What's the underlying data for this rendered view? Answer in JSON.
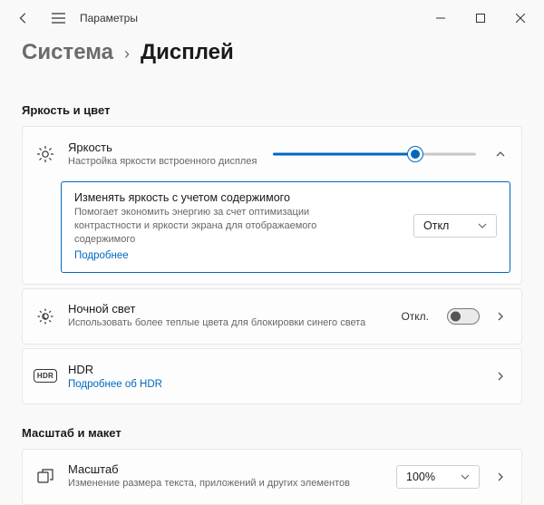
{
  "window": {
    "title": "Параметры"
  },
  "breadcrumb": {
    "parent": "Система",
    "separator": "›",
    "current": "Дисплей"
  },
  "sections": {
    "brightness_color": "Яркость и цвет",
    "scale_layout": "Масштаб и макет"
  },
  "brightness": {
    "title": "Яркость",
    "subtitle": "Настройка яркости встроенного дисплея",
    "value_percent": 70
  },
  "content_adaptive": {
    "title": "Изменять яркость с учетом содержимого",
    "description": "Помогает экономить энергию за счет оптимизации контрастности и яркости экрана для отображаемого содержимого",
    "more": "Подробнее",
    "dropdown_value": "Откл"
  },
  "night_light": {
    "title": "Ночной свет",
    "subtitle": "Использовать более теплые цвета для блокировки синего света",
    "state_label": "Откл.",
    "enabled": false
  },
  "hdr": {
    "title": "HDR",
    "more": "Подробнее об HDR",
    "badge": "HDR"
  },
  "scale": {
    "title": "Масштаб",
    "subtitle": "Изменение размера текста, приложений и других элементов",
    "dropdown_value": "100%"
  }
}
